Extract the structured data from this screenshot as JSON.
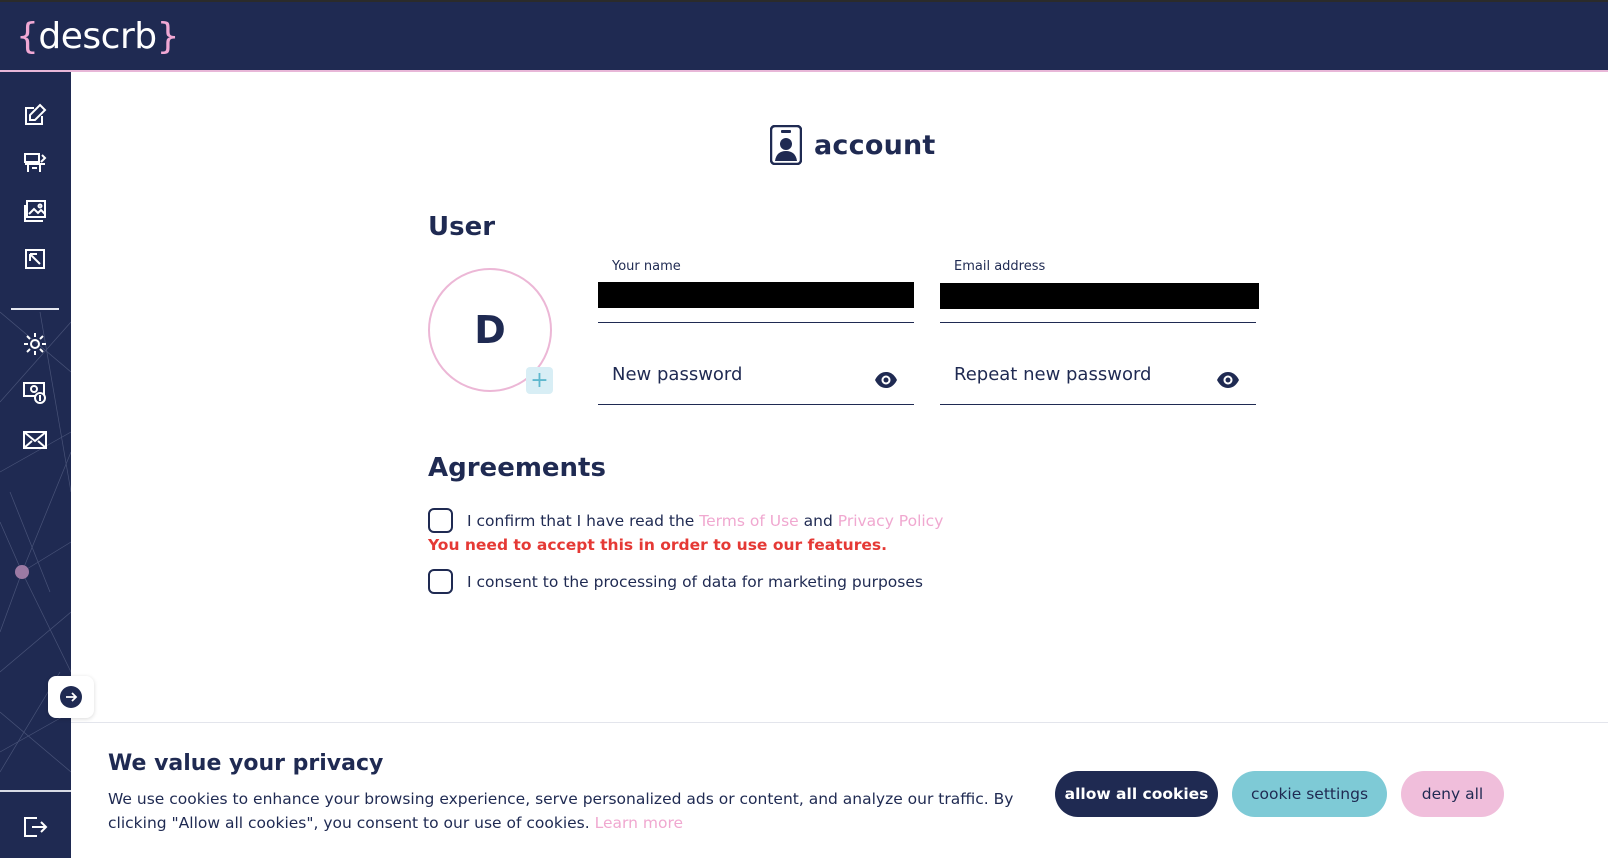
{
  "header": {
    "logo_open": "{",
    "logo_text": "descrb",
    "logo_close": "}"
  },
  "sidebar": {
    "items": [
      {
        "icon": "edit-icon"
      },
      {
        "icon": "workspace-icon"
      },
      {
        "icon": "image-gallery-icon"
      },
      {
        "icon": "export-icon"
      },
      {
        "icon": "gear-icon"
      },
      {
        "icon": "billing-icon"
      },
      {
        "icon": "mail-icon"
      }
    ],
    "bottom_icon": "logout-icon",
    "expand_icon": "arrow-right-icon"
  },
  "page": {
    "title": "account",
    "icon": "id-badge-icon"
  },
  "user": {
    "section_title": "User",
    "avatar_initial": "D",
    "avatar_add": "+",
    "name_label": "Your name",
    "email_label": "Email address",
    "new_password_placeholder": "New password",
    "repeat_password_placeholder": "Repeat new password"
  },
  "agreements": {
    "section_title": "Agreements",
    "terms_prefix": "I confirm that I have read the",
    "terms_link": "Terms of Use",
    "terms_and": "and",
    "privacy_link": "Privacy Policy",
    "terms_error": "You need to accept this in order to use our features.",
    "marketing_text": "I consent to the processing of data for marketing purposes"
  },
  "cookie_banner": {
    "title": "We value your privacy",
    "text": "We use cookies to enhance your browsing experience, serve personalized ads or content, and analyze our traffic. By clicking \"Allow all cookies\", you consent to our use of cookies.",
    "learn_more": "Learn more",
    "allow_label": "allow all cookies",
    "settings_label": "cookie settings",
    "deny_label": "deny all"
  },
  "colors": {
    "navy": "#1f2a52",
    "pink": "#f0a8d4",
    "teal": "#7ecad6",
    "error": "#e53935"
  }
}
